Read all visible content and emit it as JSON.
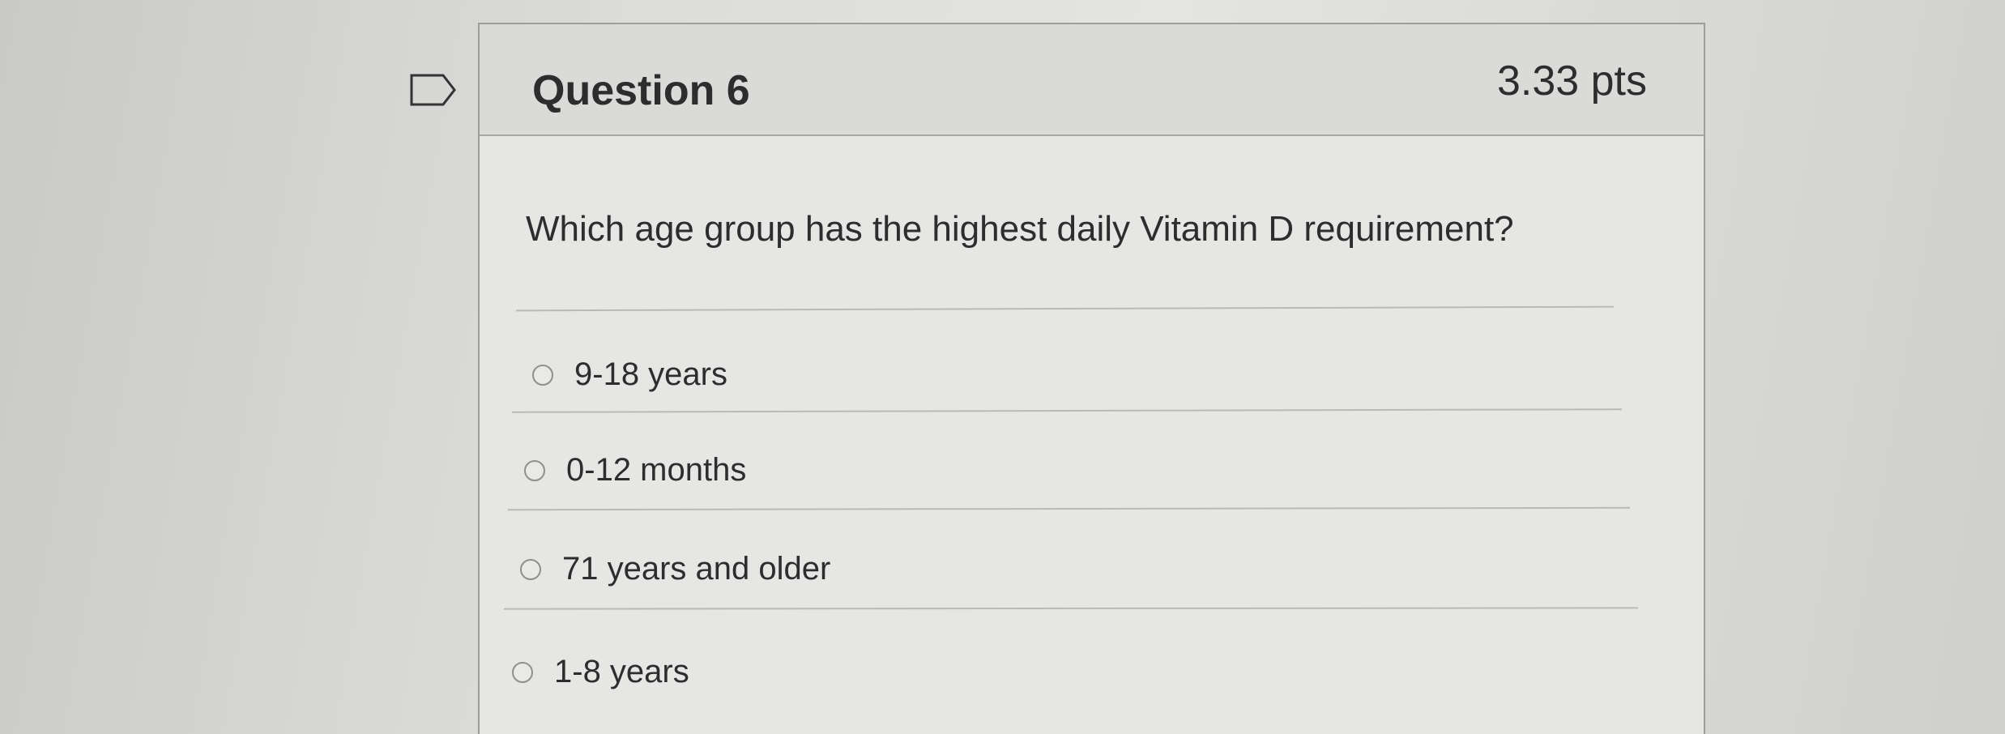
{
  "question": {
    "title": "Question 6",
    "points": "3.33 pts",
    "text": "Which age group has the highest daily Vitamin D requirement?",
    "flag_icon": "flag-outline-icon"
  },
  "answers": [
    {
      "label": "9-18 years",
      "selected": false
    },
    {
      "label": "0-12 months",
      "selected": false
    },
    {
      "label": "71 years and older",
      "selected": false
    },
    {
      "label": "1-8 years",
      "selected": false
    }
  ]
}
